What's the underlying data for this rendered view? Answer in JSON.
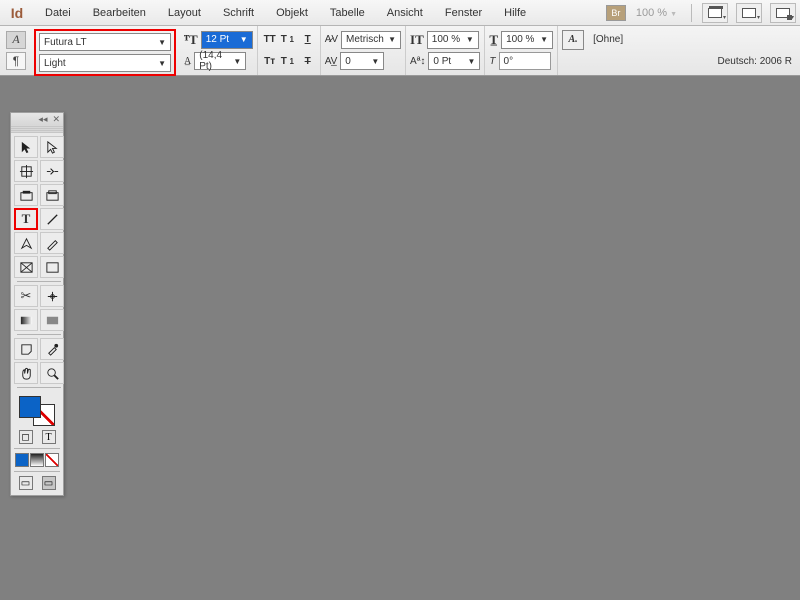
{
  "menu": {
    "items": [
      "Datei",
      "Bearbeiten",
      "Layout",
      "Schrift",
      "Objekt",
      "Tabelle",
      "Ansicht",
      "Fenster",
      "Hilfe"
    ],
    "bridge_label": "Br",
    "zoom": "100 %"
  },
  "control": {
    "font_family": "Futura LT",
    "font_style": "Light",
    "font_size": "12 Pt",
    "leading": "(14,4 Pt)",
    "kerning_mode": "Metrisch",
    "tracking": "0",
    "hscale": "100 %",
    "vscale": "100 %",
    "baseline": "0 Pt",
    "skew": "0°",
    "char_style": "[Ohne]",
    "lang": "Deutsch: 2006 R"
  }
}
